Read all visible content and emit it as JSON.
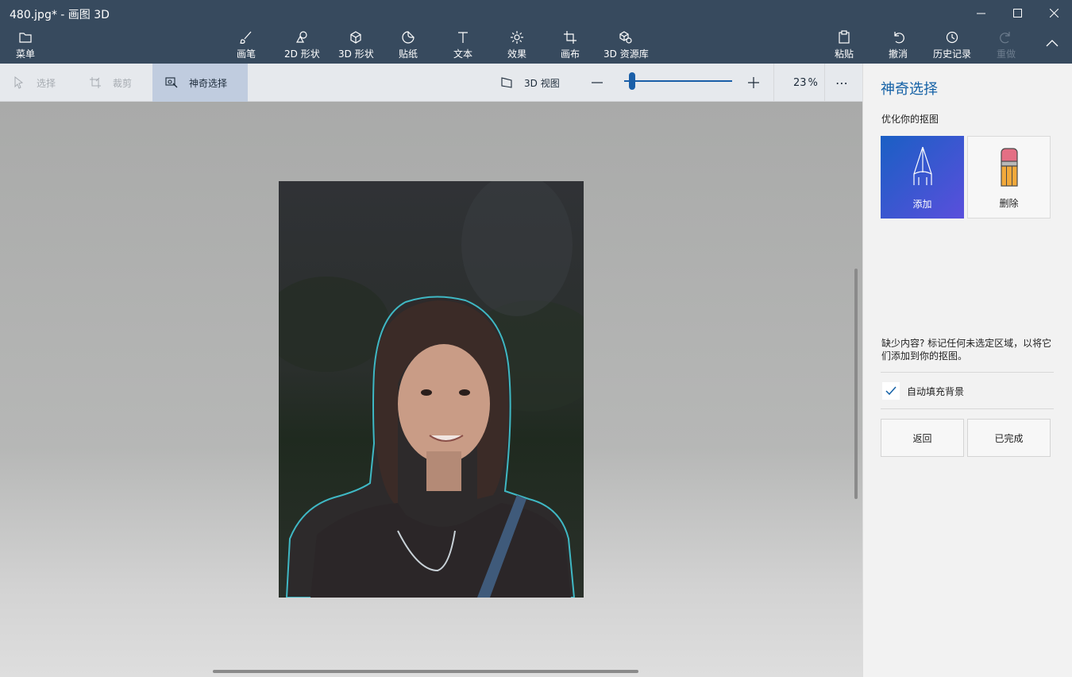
{
  "window": {
    "title": "480.jpg* - 画图 3D"
  },
  "toolbar": {
    "menu": "菜单",
    "brushes": "画笔",
    "shapes2d": "2D 形状",
    "shapes3d": "3D 形状",
    "stickers": "贴纸",
    "text": "文本",
    "effects": "效果",
    "canvas": "画布",
    "library3d": "3D 资源库",
    "paste": "粘贴",
    "undo": "撤消",
    "history": "历史记录",
    "redo": "重做"
  },
  "subbar": {
    "select": "选择",
    "crop": "裁剪",
    "magic_select": "神奇选择",
    "view3d": "3D 视图",
    "zoom_percent": "23",
    "zoom_unit": "%",
    "zoom_level": 0.08,
    "more": "⋯"
  },
  "panel": {
    "title": "神奇选择",
    "subtitle": "优化你的抠图",
    "add_label": "添加",
    "remove_label": "删除",
    "info": "缺少内容? 标记任何未选定区域，以将它们添加到你的抠图。",
    "autofill_label": "自动填充背景",
    "autofill_checked": true,
    "back_label": "返回",
    "done_label": "已完成"
  },
  "colors": {
    "titlebar": "#374a5e",
    "accent": "#1461a6",
    "add_gradient_start": "#1a5fc4",
    "add_gradient_end": "#5a4fdc",
    "selection_outline": "#3fb8c4"
  }
}
